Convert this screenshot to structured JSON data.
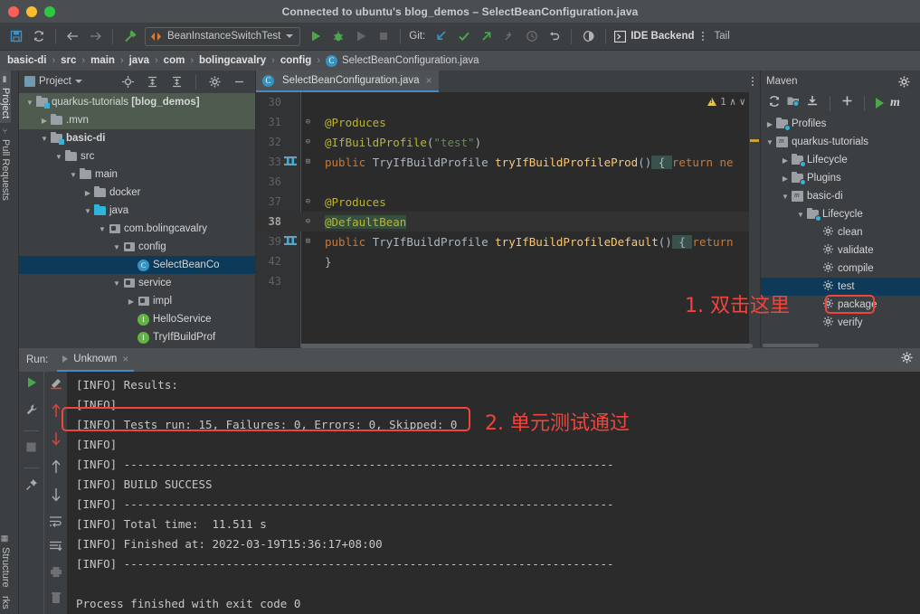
{
  "window": {
    "title": "Connected to ubuntu's blog_demos – SelectBeanConfiguration.java",
    "traffic": [
      "close",
      "minimize",
      "zoom"
    ]
  },
  "toolbar": {
    "save_icon": "save-icon",
    "sync_icon": "sync-icon",
    "back_icon": "back-arrow-icon",
    "forward_icon": "forward-arrow-icon",
    "build_icon": "build-hammer-icon",
    "run_config": "BeanInstanceSwitchTest",
    "run_icon": "run-icon",
    "debug_icon": "debug-icon",
    "run_with_coverage_icon": "run-coverage-icon",
    "stop_icon": "stop-icon",
    "git_label": "Git:",
    "git_update_icon": "git-update-icon",
    "git_commit_icon": "git-commit-icon",
    "git_push_icon": "git-push-icon",
    "git_branch_icon": "git-branch-icon",
    "git_history_icon": "git-history-icon",
    "git_rollback_icon": "git-rollback-icon",
    "search_everywhere_icon": "search-everywhere-icon",
    "ide_backend_label": "IDE Backend",
    "tail_label": "Tail"
  },
  "breadcrumb": {
    "items": [
      "basic-di",
      "src",
      "main",
      "java",
      "com",
      "bolingcavalry",
      "config"
    ],
    "file": "SelectBeanConfiguration.java",
    "separator": "›"
  },
  "rail": {
    "top": [
      "Project",
      "Pull Requests"
    ],
    "bottom": [
      "Structure",
      "rks"
    ]
  },
  "project_panel": {
    "title": "Project",
    "toolbar_icons": [
      "locate-icon",
      "expand-all-icon",
      "collapse-all-icon",
      "settings-icon",
      "hide-icon"
    ],
    "tree": [
      {
        "label": "quarkus-tutorials [blog_demos]",
        "depth": 0,
        "arrow": "down",
        "icon": "module-folder",
        "state": "selected-green",
        "bold": false,
        "bold_part": "[blog_demos]"
      },
      {
        "label": ".mvn",
        "depth": 1,
        "arrow": "right",
        "icon": "folder",
        "state": "selected-green"
      },
      {
        "label": "basic-di",
        "depth": 1,
        "arrow": "down",
        "icon": "module-folder",
        "bold": true
      },
      {
        "label": "src",
        "depth": 2,
        "arrow": "down",
        "icon": "folder"
      },
      {
        "label": "main",
        "depth": 3,
        "arrow": "down",
        "icon": "folder"
      },
      {
        "label": "docker",
        "depth": 4,
        "arrow": "right",
        "icon": "folder"
      },
      {
        "label": "java",
        "depth": 4,
        "arrow": "down",
        "icon": "source-folder"
      },
      {
        "label": "com.bolingcavalry",
        "depth": 5,
        "arrow": "down",
        "icon": "package"
      },
      {
        "label": "config",
        "depth": 6,
        "arrow": "down",
        "icon": "package"
      },
      {
        "label": "SelectBeanCo",
        "depth": 7,
        "arrow": "none",
        "icon": "class",
        "state": "selected-blue"
      },
      {
        "label": "service",
        "depth": 6,
        "arrow": "down",
        "icon": "package"
      },
      {
        "label": "impl",
        "depth": 7,
        "arrow": "right",
        "icon": "package"
      },
      {
        "label": "HelloService",
        "depth": 7,
        "arrow": "none",
        "icon": "interface"
      },
      {
        "label": "TryIfBuildProf",
        "depth": 7,
        "arrow": "none",
        "icon": "interface"
      }
    ]
  },
  "editor": {
    "tab": {
      "label": "SelectBeanConfiguration.java",
      "icon": "class-icon",
      "close": "×"
    },
    "inspection": {
      "warn_count": "1",
      "up": "∧",
      "down": "∨"
    },
    "lines": [
      {
        "num": "30",
        "tokens": []
      },
      {
        "num": "31",
        "fold": "minus",
        "tokens": [
          {
            "t": "@Produces",
            "c": "ann"
          }
        ]
      },
      {
        "num": "32",
        "fold": "minus",
        "tokens": [
          {
            "t": "@IfBuildProfile",
            "c": "ann"
          },
          {
            "t": "(",
            "c": "par"
          },
          {
            "t": "\"test\"",
            "c": "str"
          },
          {
            "t": ")",
            "c": "par"
          }
        ]
      },
      {
        "num": "33",
        "fold": "plus",
        "gmark": "implements",
        "tokens": [
          {
            "t": "public ",
            "c": "kw"
          },
          {
            "t": "TryIfBuildProfile ",
            "c": "type"
          },
          {
            "t": "tryIfBuildProfileProd",
            "c": "meth"
          },
          {
            "t": "()",
            "c": "par"
          },
          {
            "t": " { ",
            "c": "brace"
          },
          {
            "t": "return ne",
            "c": "kw"
          }
        ]
      },
      {
        "num": "36",
        "tokens": []
      },
      {
        "num": "37",
        "fold": "minus",
        "tokens": [
          {
            "t": "@Produces",
            "c": "ann"
          }
        ]
      },
      {
        "num": "38",
        "fold": "minus",
        "current": true,
        "tokens": [
          {
            "t": "@DefaultBean",
            "c": "ann-hl"
          }
        ]
      },
      {
        "num": "39",
        "fold": "plus",
        "gmark": "implements",
        "tokens": [
          {
            "t": "public ",
            "c": "kw"
          },
          {
            "t": "TryIfBuildProfile ",
            "c": "type"
          },
          {
            "t": "tryIfBuildProfileDefault",
            "c": "meth"
          },
          {
            "t": "()",
            "c": "par"
          },
          {
            "t": " { ",
            "c": "brace"
          },
          {
            "t": "return",
            "c": "kw"
          }
        ]
      },
      {
        "num": "42",
        "tokens": [
          {
            "t": "}",
            "c": "par"
          }
        ]
      },
      {
        "num": "43",
        "tokens": []
      }
    ]
  },
  "maven_panel": {
    "title": "Maven",
    "settings_icon": "gear-icon",
    "toolbar_icons": [
      "reload-icon",
      "generate-sources-icon",
      "download-sources-icon",
      "add-icon",
      "run-icon",
      "maven-m-icon"
    ],
    "tree": [
      {
        "label": "Profiles",
        "depth": 0,
        "arrow": "right",
        "icon": "profiles"
      },
      {
        "label": "quarkus-tutorials",
        "depth": 0,
        "arrow": "down",
        "icon": "maven-module"
      },
      {
        "label": "Lifecycle",
        "depth": 1,
        "arrow": "right",
        "icon": "lifecycle-folder"
      },
      {
        "label": "Plugins",
        "depth": 1,
        "arrow": "right",
        "icon": "lifecycle-folder"
      },
      {
        "label": "basic-di",
        "depth": 1,
        "arrow": "down",
        "icon": "maven-module"
      },
      {
        "label": "Lifecycle",
        "depth": 2,
        "arrow": "down",
        "icon": "lifecycle-folder"
      },
      {
        "label": "clean",
        "depth": 3,
        "arrow": "none",
        "icon": "goal"
      },
      {
        "label": "validate",
        "depth": 3,
        "arrow": "none",
        "icon": "goal"
      },
      {
        "label": "compile",
        "depth": 3,
        "arrow": "none",
        "icon": "goal"
      },
      {
        "label": "test",
        "depth": 3,
        "arrow": "none",
        "icon": "goal",
        "state": "selected-blue"
      },
      {
        "label": "package",
        "depth": 3,
        "arrow": "none",
        "icon": "goal"
      },
      {
        "label": "verify",
        "depth": 3,
        "arrow": "none",
        "icon": "goal"
      }
    ]
  },
  "run_panel": {
    "label": "Run:",
    "tab": "Unknown",
    "tab_close": "×",
    "settings_icon": "gear-icon",
    "side_icons": [
      "rerun-icon",
      "wrench-icon",
      "stop-icon",
      "pin-icon"
    ],
    "side_icons2": [
      "toggle-soft-wrap-icon",
      "up-red-icon",
      "down-red-icon",
      "up-icon",
      "down-icon",
      "soft-wrap-icon",
      "scroll-to-end-icon",
      "print-icon",
      "clear-all-icon"
    ],
    "console": [
      "[INFO] Results:",
      "[INFO]",
      "[INFO] Tests run: 15, Failures: 0, Errors: 0, Skipped: 0",
      "[INFO]",
      "[INFO] ------------------------------------------------------------------------",
      "[INFO] BUILD SUCCESS",
      "[INFO] ------------------------------------------------------------------------",
      "[INFO] Total time:  11.511 s",
      "[INFO] Finished at: 2022-03-19T15:36:17+08:00",
      "[INFO] ------------------------------------------------------------------------",
      "",
      "Process finished with exit code 0"
    ]
  },
  "annotations": {
    "color": "#f0453c",
    "items": [
      {
        "text": "1. 双击这里",
        "name": "annotation-step-1"
      },
      {
        "text": "2. 单元测试通过",
        "name": "annotation-step-2"
      }
    ]
  }
}
